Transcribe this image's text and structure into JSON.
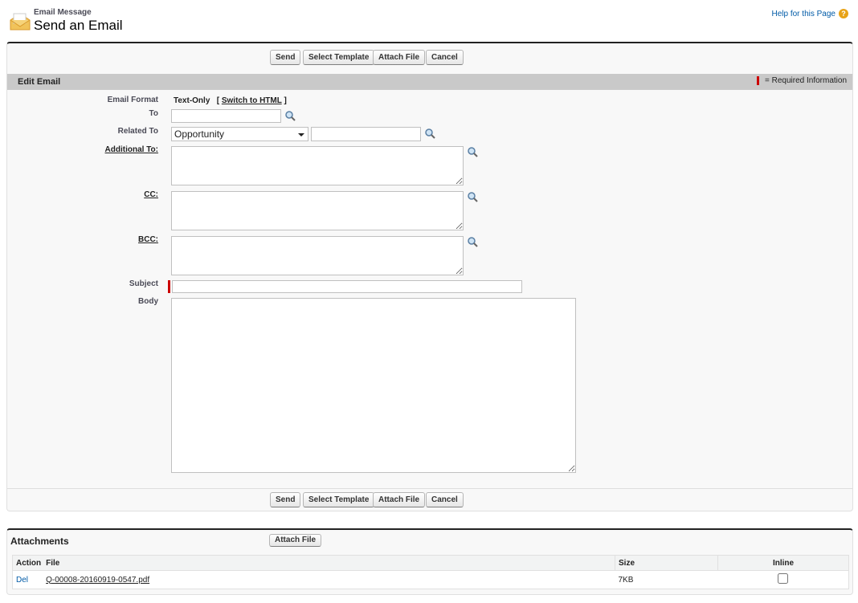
{
  "header": {
    "subtitle": "Email Message",
    "title": "Send an Email",
    "help_link": "Help for this Page"
  },
  "buttons": {
    "send": "Send",
    "select_template": "Select Template",
    "attach_file": "Attach File",
    "cancel": "Cancel"
  },
  "section": {
    "title": "Edit Email",
    "required_legend": "= Required Information"
  },
  "form": {
    "email_format_label": "Email Format",
    "email_format_value": "Text-Only",
    "switch_open": "[",
    "switch_link": "Switch to HTML",
    "switch_close": "]",
    "to_label": "To",
    "to_value": "",
    "related_to_label": "Related To",
    "related_to_type": "Opportunity",
    "related_to_value": "",
    "additional_to_label": "Additional To:",
    "cc_label": "CC:",
    "bcc_label": "BCC:",
    "subject_label": "Subject",
    "subject_value": "",
    "body_label": "Body",
    "body_value": ""
  },
  "attachments": {
    "title": "Attachments",
    "attach_button": "Attach File",
    "columns": {
      "action": "Action",
      "file": "File",
      "size": "Size",
      "inline": "Inline"
    },
    "rows": [
      {
        "action": "Del",
        "file": "Q-00008-20160919-0547.pdf",
        "size": "7KB",
        "inline": false
      }
    ]
  },
  "colors": {
    "required": "#c00",
    "section_bar": "#c9c9c9",
    "link": "#015ba7"
  }
}
